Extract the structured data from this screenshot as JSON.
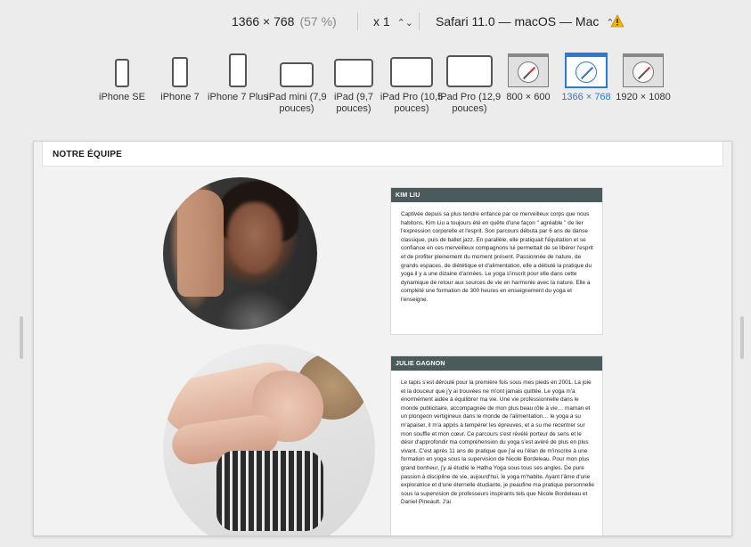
{
  "toolbar": {
    "resolution": "1366 × 768",
    "zoom_percent": "(57 %)",
    "scale": "x 1",
    "browser": "Safari 11.0 — macOS — Mac",
    "stepper_glyph": "⌃⌄",
    "warning_icon": "warning-triangle-icon",
    "warning_color": "#f2b400"
  },
  "devices": [
    {
      "label": "iPhone SE",
      "kind": "phone"
    },
    {
      "label": "iPhone 7",
      "kind": "phone"
    },
    {
      "label": "iPhone 7 Plus",
      "kind": "phone"
    },
    {
      "label": "iPad mini (7,9 pouces)",
      "kind": "tablet"
    },
    {
      "label": "iPad (9,7 pouces)",
      "kind": "tablet"
    },
    {
      "label": "iPad Pro (10,5 pouces)",
      "kind": "tablet"
    },
    {
      "label": "iPad Pro (12,9 pouces)",
      "kind": "tablet"
    },
    {
      "label": "800 × 600",
      "kind": "desktop"
    },
    {
      "label": "1366 × 768",
      "kind": "desktop",
      "active": true
    },
    {
      "label": "1920 × 1080",
      "kind": "desktop"
    }
  ],
  "accent_color": "#2a7bd6",
  "page": {
    "section_title": "NOTRE ÉQUIPE",
    "members": [
      {
        "name": "KIM LIU",
        "bio": "Captivée depuis sa plus tendre enfance par ce merveilleux corps que nous habitons, Kim Liu a toujours été en quête d'une façon \" agréable \" de lier l'expression corporelle et l'esprit. Son parcours débuta par 6 ans de danse classique, puis de ballet jazz. En parallèle, elle pratiquait l'équitation et se confiance en ces merveilleux compagnons lui permettait de se libérer l'esprit et de profiter pleinement du moment présent. Passionnée de nature, de grands espaces, de diététique et d'alimentation, elle a débuté la pratique du yoga il y a une dizaine d'années. Le yoga s'inscrit pour elle dans cette dynamique de retour aux sources de vie en harmonie avec la nature. Elle a complété une formation de 300 heures en enseignement du yoga et l'enseigne."
      },
      {
        "name": "JULIE GAGNON",
        "bio": "Le tapis s'est déroulé pour la première fois sous mes pieds en 2001. La joie et la douceur que j'y ai trouvées ne m'ont jamais quittée. Le yoga m'a énormément aidée à équilibrer ma vie. Une vie professionnelle dans le monde publicitaire, accompagnée de mon plus beau rôle à vie… maman et un plongeon vertigineux dans le monde de l'alimentation… le yoga a su m'apaiser, il m'a appris à tempérer les épreuves, et a su me recentrer sur mon souffle et mon cœur. Ce parcours s'est révélé porteur de sens et le désir d'approfondir ma compréhension du yoga s'est avéré de plus en plus vivant. C'est après 11 ans de pratique que j'ai eu l'élan de m'inscrire à une formation en yoga sous la supervision de Nicole Bordeleau. Pour mon plus grand bonheur, j'y ai étudié le Hatha Yoga sous tous ses angles. De pure passion à discipline de vie, aujourd'hui, le yoga m'habite. Ayant l'âme d'une exploratrice et d'une éternelle étudiante, je peaufine ma pratique personnelle sous la supervision de professeurs inspirants tels que Nicole Bordeleau et Daniel Pineault. J'ai"
      }
    ]
  }
}
